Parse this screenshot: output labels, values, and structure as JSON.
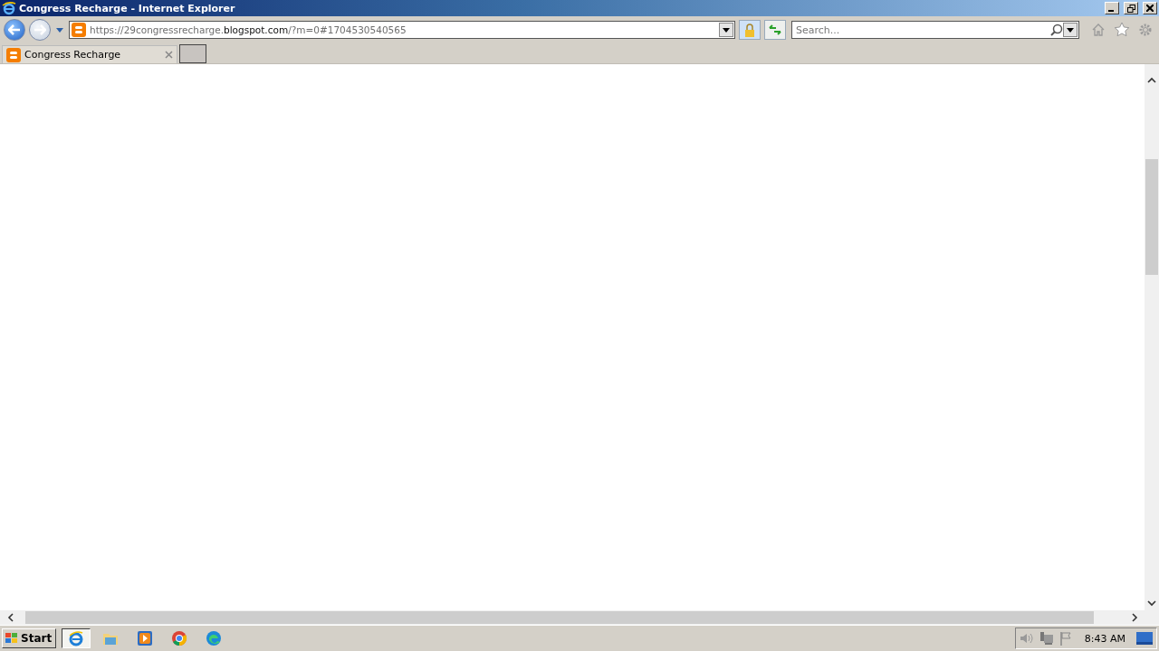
{
  "window": {
    "title": "Congress Recharge - Internet Explorer"
  },
  "address_bar": {
    "url_parts": [
      {
        "text": "https://29congressrecharge.",
        "kind": "dim"
      },
      {
        "text": "blogspot.com",
        "kind": "domain"
      },
      {
        "text": "/?m=0#1704530540565",
        "kind": "dim"
      }
    ]
  },
  "search": {
    "placeholder": "Search..."
  },
  "tabs": [
    {
      "label": "Congress Recharge",
      "selected": true
    }
  ],
  "taskbar": {
    "start_label": "Start",
    "apps": [
      {
        "kind": "ie",
        "selected": true
      },
      {
        "kind": "folder",
        "selected": false
      },
      {
        "kind": "media",
        "selected": false
      },
      {
        "kind": "chrome",
        "selected": false
      },
      {
        "kind": "edge",
        "selected": false
      }
    ],
    "clock": "8:43 AM"
  }
}
